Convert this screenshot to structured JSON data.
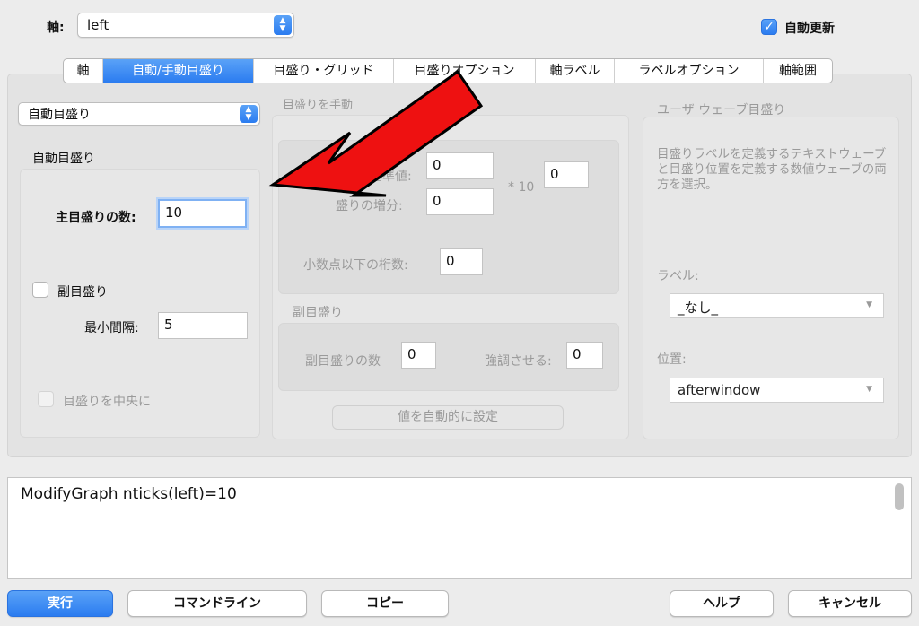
{
  "header": {
    "axis_label": "軸:",
    "axis_value": "left",
    "auto_update_label": "自動更新",
    "auto_update_checked": true
  },
  "tabs": [
    {
      "label": "軸",
      "active": false
    },
    {
      "label": "自動/手動目盛り",
      "active": true
    },
    {
      "label": "目盛り・グリッド",
      "active": false
    },
    {
      "label": "目盛りオプション",
      "active": false
    },
    {
      "label": "軸ラベル",
      "active": false
    },
    {
      "label": "ラベルオプション",
      "active": false
    },
    {
      "label": "軸範囲",
      "active": false
    }
  ],
  "left": {
    "mode_value": "自動目盛り",
    "group_title": "自動目盛り",
    "major_label": "主目盛りの数:",
    "major_value": "10",
    "minor_label": "副目盛り",
    "minor_checked": false,
    "min_spacing_label": "最小間隔:",
    "min_spacing_value": "5",
    "center_label": "目盛りを中央に"
  },
  "manual": {
    "title": "目盛りを手動",
    "base_label": "基準値:",
    "base_value": "0",
    "increment_label": "盛りの増分:",
    "increment_value": "0",
    "times_label": "* 10",
    "exponent_value": "0",
    "decimals_label": "小数点以下の桁数:",
    "decimals_value": "0",
    "minor_title": "副目盛り",
    "minor_count_label": "副目盛りの数",
    "minor_count_value": "0",
    "emphasize_label": "強調させる:",
    "emphasize_value": "0",
    "auto_set_button": "値を自動的に設定"
  },
  "user_wave": {
    "title": "ユーザ ウェーブ目盛り",
    "description": "目盛りラベルを定義するテキストウェーブと目盛り位置を定義する数値ウェーブの両方を選択。",
    "label_title": "ラベル:",
    "label_value": "_なし_",
    "position_title": "位置:",
    "position_value": "afterwindow"
  },
  "command_text": "ModifyGraph nticks(left)=10",
  "buttons": {
    "execute": "実行",
    "command_line": "コマンドライン",
    "copy": "コピー",
    "help": "ヘルプ",
    "cancel": "キャンセル"
  },
  "annotation": {
    "arrow_color": "#ee1111",
    "arrow_icon": "red-arrow-icon"
  },
  "colors": {
    "accent": "#2b7cf0",
    "background": "#ececec"
  }
}
